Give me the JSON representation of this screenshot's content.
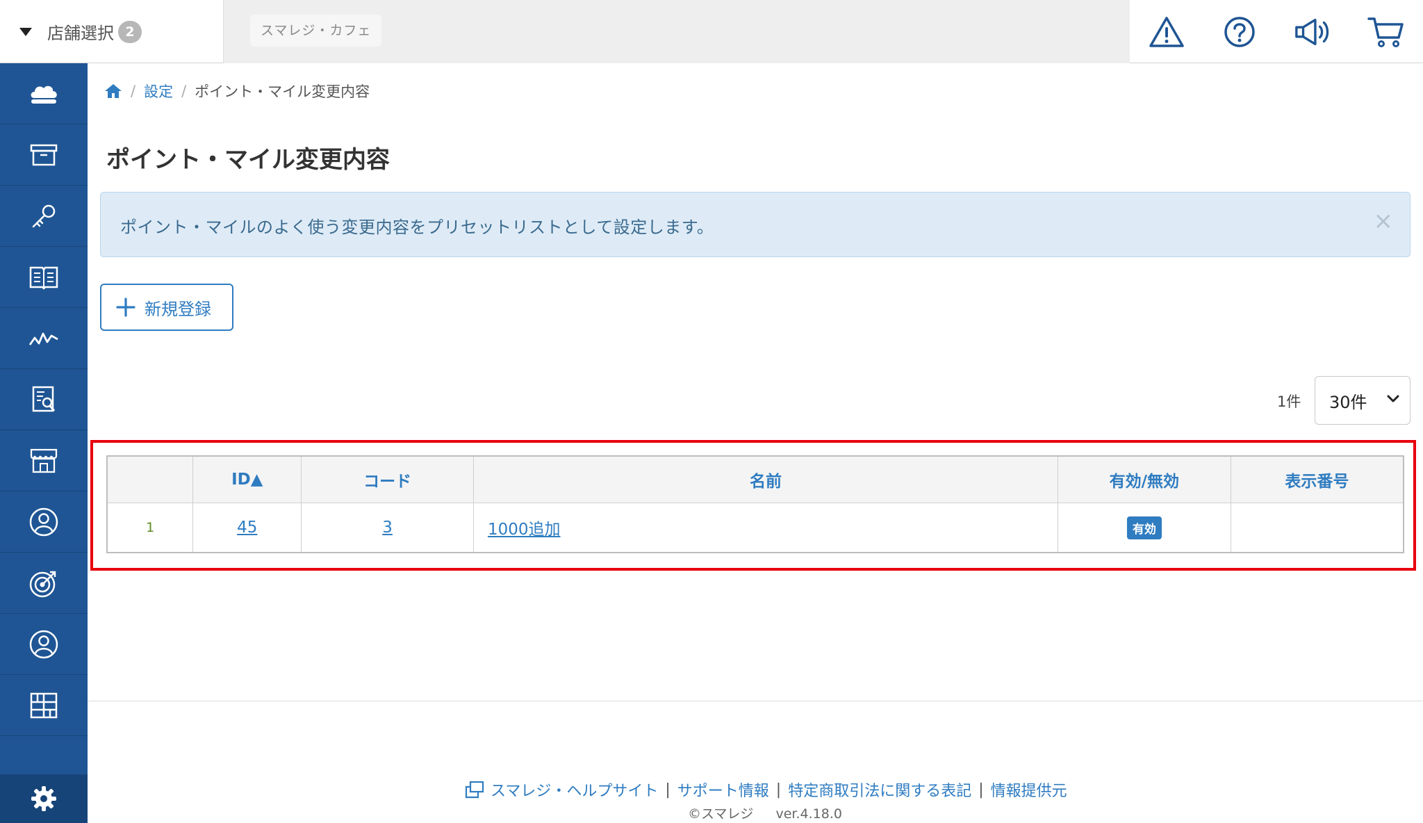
{
  "header": {
    "store_select_label": "店舗選択",
    "store_count": "2",
    "store_chip": "スマレジ・カフェ",
    "icons": [
      "warning-icon",
      "help-icon",
      "megaphone-icon",
      "cart-icon"
    ]
  },
  "sidebar": {
    "items": [
      "cloud-icon",
      "archive-box-icon",
      "key-icon",
      "book-icon",
      "chart-line-icon",
      "report-icon",
      "store-icon",
      "customer-icon",
      "target-icon",
      "user-icon",
      "grid-icon"
    ],
    "bottom": "gear-icon",
    "color": "#1f5594"
  },
  "breadcrumb": {
    "home": "home-icon",
    "sep": "/",
    "settings": "設定",
    "current": "ポイント・マイル変更内容"
  },
  "page": {
    "title": "ポイント・マイル変更内容",
    "alert_text": "ポイント・マイルのよく使う変更内容をプリセットリストとして設定します。",
    "alert_close": "×",
    "new_button": "新規登録",
    "count_label": "1件",
    "per_page": "30件"
  },
  "table": {
    "headers": [
      "",
      "ID▲",
      "コード",
      "名前",
      "有効/無効",
      "表示番号"
    ],
    "rows": [
      {
        "num": "1",
        "id": "45",
        "code": "3",
        "name": "1000追加",
        "status": "有効",
        "display_no": ""
      }
    ]
  },
  "footer": {
    "help_site": "スマレジ・ヘルプサイト",
    "separator": "|",
    "support": "サポート情報",
    "legal": "特定商取引法に関する表記",
    "info_provider": "情報提供元",
    "copyright": "©スマレジ",
    "version": "ver.4.18.0"
  },
  "colors": {
    "accent": "#2f7cc1",
    "highlight": "#e8000d",
    "alert_bg": "#deebf6"
  }
}
